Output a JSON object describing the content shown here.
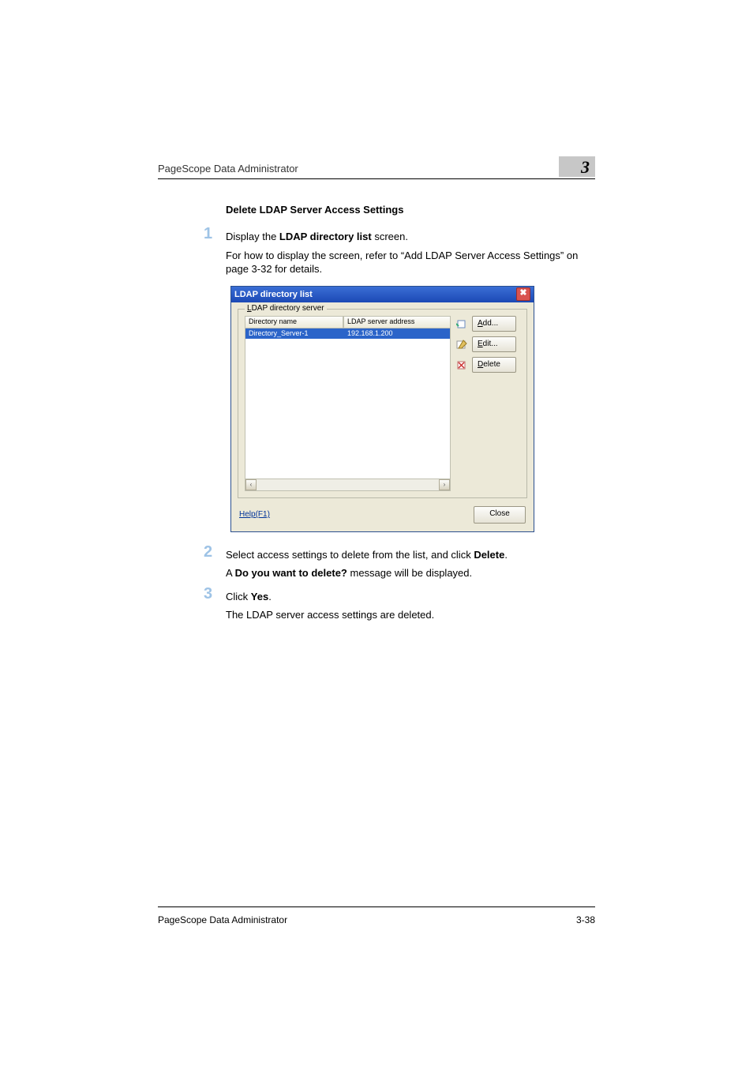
{
  "page": {
    "running_head": "PageScope Data Administrator",
    "chapter_number": "3",
    "footer_left": "PageScope Data Administrator",
    "footer_right": "3-38"
  },
  "section_title": "Delete LDAP Server Access Settings",
  "steps": {
    "s1": {
      "num": "1",
      "line1_pre": "Display the ",
      "line1_bold": "LDAP directory list",
      "line1_post": " screen.",
      "line2": "For how to display the screen, refer to “Add LDAP Server Access Settings” on page 3-32 for details."
    },
    "s2": {
      "num": "2",
      "line1_pre": "Select access settings to delete from the list, and click ",
      "line1_bold": "Delete",
      "line1_post": ".",
      "line2_pre": "A ",
      "line2_bold": "Do you want to delete?",
      "line2_post": " message will be displayed."
    },
    "s3": {
      "num": "3",
      "line1_pre": "Click ",
      "line1_bold": "Yes",
      "line1_post": ".",
      "line2": "The LDAP server access settings are deleted."
    }
  },
  "dialog": {
    "title": "LDAP directory list",
    "close_glyph": "✖",
    "group_legend_ul": "L",
    "group_legend_rest": "DAP directory server",
    "columns": {
      "name": "Directory name",
      "addr": "LDAP server address"
    },
    "rows": [
      {
        "name": "Directory_Server-1",
        "addr": "192.168.1.200"
      }
    ],
    "scroll_left": "‹",
    "scroll_right": "›",
    "buttons": {
      "add_ul": "A",
      "add_rest": "dd...",
      "edit_ul": "E",
      "edit_rest": "dit...",
      "del_ul": "D",
      "del_rest": "elete"
    },
    "help_link": "Help(F1)",
    "close_btn": "Close"
  }
}
